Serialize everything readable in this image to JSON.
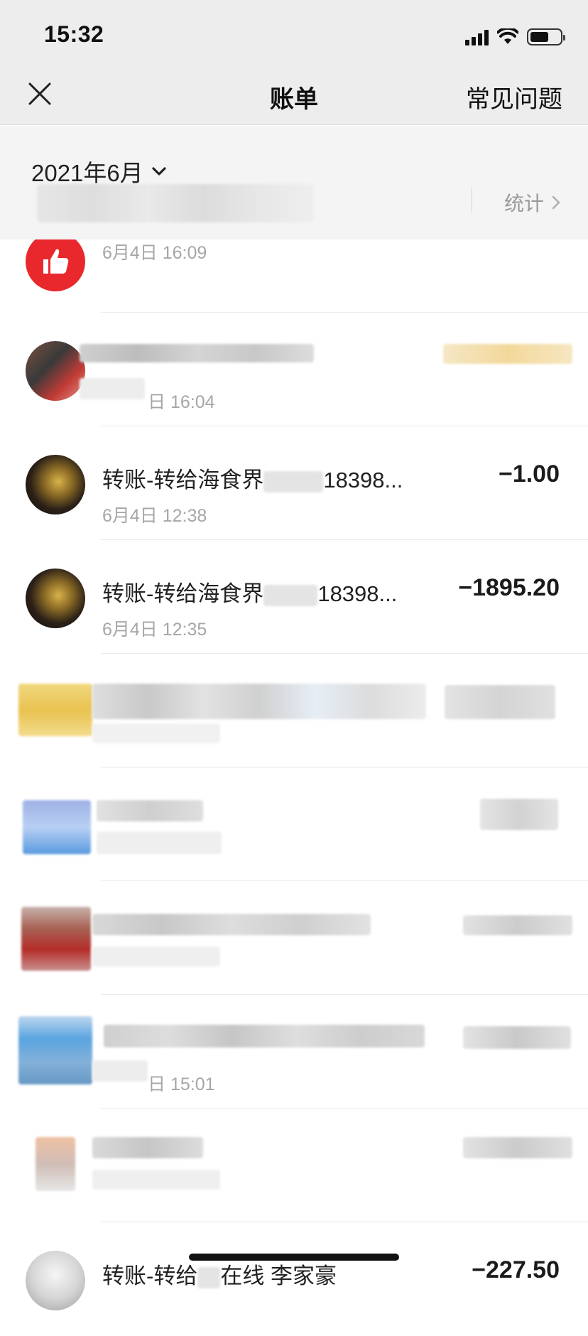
{
  "status_bar": {
    "time": "15:32"
  },
  "nav": {
    "title": "账单",
    "faq": "常见问题"
  },
  "month_bar": {
    "month": "2021年6月",
    "stats_label": "统计"
  },
  "bills": [
    {
      "title": "",
      "time": "6月4日 16:09",
      "amount": ""
    },
    {
      "title": "",
      "time": "日 16:04",
      "amount": ""
    },
    {
      "title": "转账-转给海食界",
      "title_tail": "18398...",
      "time": "6月4日 12:38",
      "amount": "−1.00"
    },
    {
      "title": "转账-转给海食界",
      "title_tail": "18398...",
      "time": "6月4日 12:35",
      "amount": "−1895.20"
    },
    {
      "title": "",
      "time": "",
      "amount": ""
    },
    {
      "title": "",
      "time": "",
      "amount": ""
    },
    {
      "title": "",
      "time": "",
      "amount": ""
    },
    {
      "title": "",
      "time": "日 15:01",
      "amount": ""
    },
    {
      "title": "",
      "time": "",
      "amount": ""
    },
    {
      "title": "转账-转给",
      "title_tail": "在线 李家豪",
      "time": "",
      "amount": "−227.50"
    }
  ],
  "colors": {
    "thumbs_red": "#e8282c",
    "background": "#ffffff",
    "header_bg": "#ededed"
  }
}
